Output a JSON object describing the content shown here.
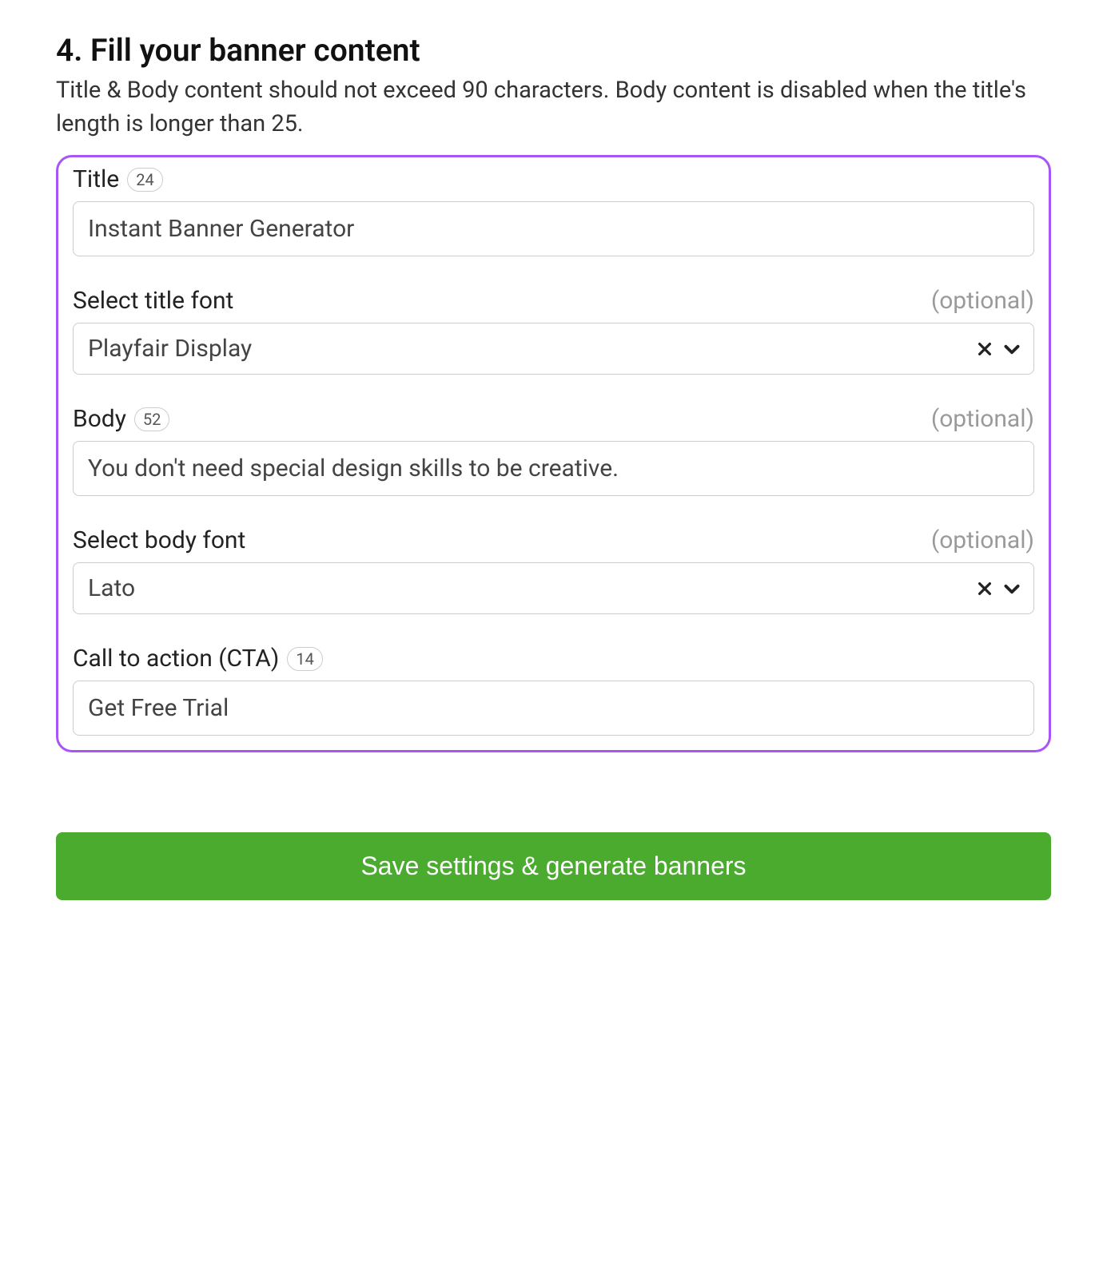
{
  "heading": "4. Fill your banner content",
  "description": "Title & Body content should not exceed 90 characters. Body content is disabled when the title's length is longer than 25.",
  "optional_label": "(optional)",
  "fields": {
    "title": {
      "label": "Title",
      "count": "24",
      "value": "Instant Banner Generator"
    },
    "title_font": {
      "label": "Select title font",
      "value": "Playfair Display"
    },
    "body": {
      "label": "Body",
      "count": "52",
      "value": "You don't need special design skills to be creative."
    },
    "body_font": {
      "label": "Select body font",
      "value": "Lato"
    },
    "cta": {
      "label": "Call to action (CTA)",
      "count": "14",
      "value": "Get Free Trial"
    }
  },
  "submit_label": "Save settings & generate banners"
}
